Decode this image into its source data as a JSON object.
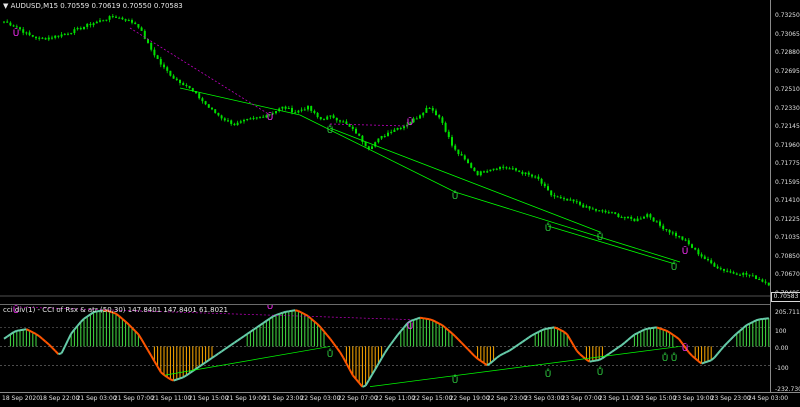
{
  "header": {
    "symbol": "AUDUSD,M15",
    "ohlc": "0.70559 0.70619 0.70550 0.70583",
    "arrow": "▼"
  },
  "indicator": {
    "label": "cci div(1) - CCI of Rsx & atr (50,30) 147.8401 147.8401 61.8021"
  },
  "price_axis": {
    "labels": [
      "0.73250",
      "0.73065",
      "0.72880",
      "0.72695",
      "0.72510",
      "0.72330",
      "0.72145",
      "0.71960",
      "0.71775",
      "0.71595",
      "0.71410",
      "0.71225",
      "0.71035",
      "0.70850",
      "0.70670",
      "0.70485"
    ],
    "current_price": "0.70583"
  },
  "indicator_axis": {
    "labels": [
      "205.7116",
      "100",
      "0.00",
      "-100",
      "-232.7309"
    ]
  },
  "time_axis": {
    "labels": [
      "18 Sep 2020",
      "18 Sep 22:00",
      "21 Sep 03:00",
      "21 Sep 07:00",
      "21 Sep 11:00",
      "21 Sep 15:00",
      "21 Sep 19:00",
      "21 Sep 23:00",
      "22 Sep 03:00",
      "22 Sep 07:00",
      "22 Sep 11:00",
      "22 Sep 15:00",
      "22 Sep 19:00",
      "22 Sep 23:00",
      "23 Sep 03:00",
      "23 Sep 07:00",
      "23 Sep 11:00",
      "23 Sep 15:00",
      "23 Sep 19:00",
      "23 Sep 23:00",
      "24 Sep 03:00"
    ]
  },
  "chart_data": {
    "type": "candlestick",
    "symbol": "AUDUSD",
    "timeframe": "M15",
    "ylim": [
      0.70485,
      0.733
    ],
    "close_approx": [
      0.7313,
      0.7308,
      0.73,
      0.7296,
      0.7298,
      0.7301,
      0.7305,
      0.731,
      0.7314,
      0.7318,
      0.7315,
      0.731,
      0.7288,
      0.727,
      0.7258,
      0.7251,
      0.724,
      0.7228,
      0.7219,
      0.7213,
      0.7217,
      0.722,
      0.7224,
      0.723,
      0.7225,
      0.723,
      0.7218,
      0.7221,
      0.7215,
      0.7205,
      0.719,
      0.72,
      0.7208,
      0.7212,
      0.722,
      0.7231,
      0.7218,
      0.719,
      0.7178,
      0.7165,
      0.717,
      0.7172,
      0.7169,
      0.7165,
      0.716,
      0.7145,
      0.714,
      0.7138,
      0.7132,
      0.7129,
      0.7127,
      0.7123,
      0.712,
      0.7126,
      0.7115,
      0.7108,
      0.7101,
      0.709,
      0.708,
      0.7073,
      0.7069,
      0.7068,
      0.7064,
      0.70583
    ],
    "cci_series": [
      {
        "name": "CCI of Rsx & atr (50,30)",
        "values": [
          40,
          80,
          90,
          60,
          10,
          -50,
          70,
          140,
          180,
          190,
          170,
          120,
          60,
          -40,
          -140,
          -180,
          -160,
          -120,
          -80,
          -40,
          0,
          40,
          80,
          120,
          160,
          180,
          190,
          160,
          110,
          40,
          -40,
          -150,
          -220,
          -120,
          -20,
          60,
          130,
          150,
          140,
          110,
          60,
          0,
          -60,
          -100,
          -50,
          -20,
          20,
          60,
          90,
          100,
          70,
          -30,
          -80,
          -70,
          -30,
          10,
          60,
          90,
          100,
          80,
          40,
          -40,
          -90,
          -70,
          0,
          60,
          110,
          140,
          147
        ]
      }
    ],
    "indicator_levels": [
      205.7116,
      100,
      0,
      -100,
      -232.7309
    ],
    "markers": {
      "divergence_top": "Ū",
      "divergence_bottom": "Ů"
    }
  },
  "colors": {
    "background": "#000000",
    "candle": "#00e000",
    "trendline": "#00ff00",
    "divergence_line": "#c000c0",
    "divergence_marker_top": "#ff30ff",
    "divergence_marker_bottom": "#2ecc40",
    "cci_up": "#66ccaa",
    "cci_down": "#ff5500",
    "hist_up": "#44dd44",
    "hist_down": "#ffaa00",
    "level_line": "#7a7a7a"
  }
}
